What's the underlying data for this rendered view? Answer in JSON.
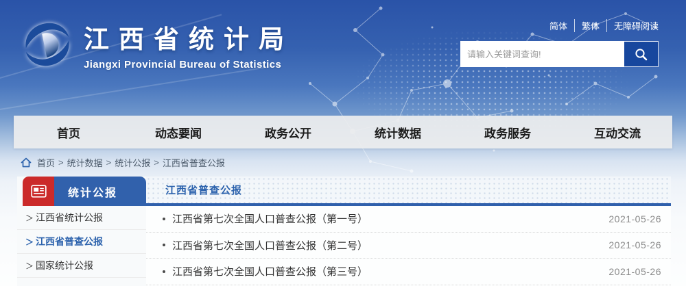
{
  "brand": {
    "title": "江西省统计局",
    "subtitle": "Jiangxi Provincial Bureau of Statistics"
  },
  "header": {
    "lang_links": [
      "简体",
      "繁体",
      "无障碍阅读"
    ],
    "search": {
      "placeholder": "请输入关键词查询!"
    }
  },
  "nav": {
    "items": [
      {
        "label": "首页"
      },
      {
        "label": "动态要闻"
      },
      {
        "label": "政务公开"
      },
      {
        "label": "统计数据"
      },
      {
        "label": "政务服务"
      },
      {
        "label": "互动交流"
      }
    ]
  },
  "breadcrumb": {
    "items": [
      "首页",
      "统计数据",
      "统计公报",
      "江西省普查公报"
    ],
    "separator": ">"
  },
  "sidebar": {
    "title": "统计公报",
    "prefix": "＞",
    "items": [
      {
        "label": "江西省统计公报",
        "active": false
      },
      {
        "label": "江西省普查公报",
        "active": true
      },
      {
        "label": "国家统计公报",
        "active": false
      }
    ]
  },
  "main": {
    "tab": "江西省普查公报",
    "list": [
      {
        "title": "江西省第七次全国人口普查公报（第一号）",
        "date": "2021-05-26"
      },
      {
        "title": "江西省第七次全国人口普查公报（第二号）",
        "date": "2021-05-26"
      },
      {
        "title": "江西省第七次全国人口普查公报（第三号）",
        "date": "2021-05-26"
      }
    ]
  },
  "colors": {
    "header_blue": "#2a53a8",
    "accent_blue": "#3161ac",
    "accent_red": "#cb2a2a",
    "active_link_blue": "#2d63ad",
    "date_gray": "#8a8a8a",
    "search_button_blue": "#17479e"
  }
}
